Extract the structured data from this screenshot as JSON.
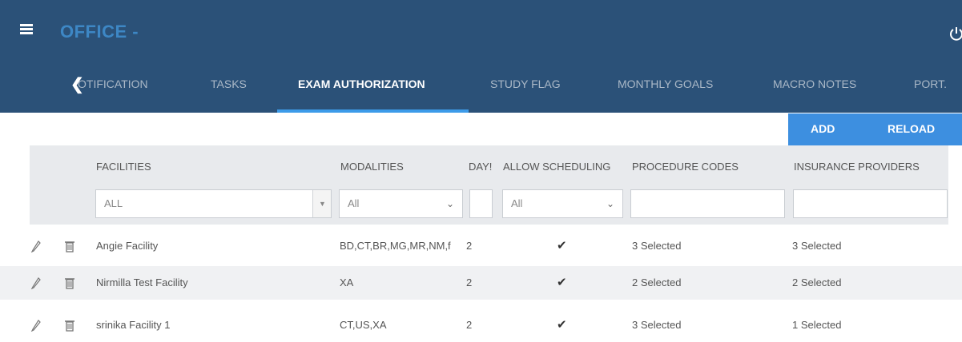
{
  "header": {
    "app_title": "OFFICE -",
    "menu_icon": "hamburger-icon",
    "power_icon": "power-icon",
    "colors": {
      "bar": "#2b5178",
      "title": "#3d87c5",
      "accent": "#3d9be9"
    }
  },
  "tabs": {
    "scroll_left_icon": "chevron-left-icon",
    "items": [
      {
        "label": "OTIFICATION"
      },
      {
        "label": "TASKS"
      },
      {
        "label": "EXAM AUTHORIZATION"
      },
      {
        "label": "STUDY FLAG"
      },
      {
        "label": "MONTHLY GOALS"
      },
      {
        "label": "MACRO NOTES"
      },
      {
        "label": "PORT."
      }
    ],
    "active_index": 2
  },
  "actions": {
    "add_label": "ADD",
    "reload_label": "RELOAD"
  },
  "grid": {
    "columns": {
      "facilities": "FACILITIES",
      "modalities": "MODALITIES",
      "days": "DAY!",
      "allow_scheduling": "ALLOW SCHEDULING",
      "procedure_codes": "PROCEDURE CODES",
      "insurance_providers": "INSURANCE PROVIDERS"
    },
    "filters": {
      "facilities": "ALL",
      "modalities": "All",
      "days": "",
      "allow_scheduling": "All",
      "procedure_codes": "",
      "insurance_providers": ""
    },
    "rows": [
      {
        "facility": "Angie Facility",
        "modalities": "BD,CT,BR,MG,MR,NM,f",
        "days": "2",
        "allow_scheduling": true,
        "procedure_codes": "3 Selected",
        "insurance_providers": "3 Selected"
      },
      {
        "facility": "Nirmilla Test Facility",
        "modalities": "XA",
        "days": "2",
        "allow_scheduling": true,
        "procedure_codes": "2 Selected",
        "insurance_providers": "2 Selected"
      },
      {
        "facility": "srinika Facility 1",
        "modalities": "CT,US,XA",
        "days": "2",
        "allow_scheduling": true,
        "procedure_codes": "3 Selected",
        "insurance_providers": "1 Selected"
      }
    ],
    "row_icons": {
      "edit": "pencil-icon",
      "delete": "trash-icon",
      "allowed": "checkmark-icon"
    }
  }
}
